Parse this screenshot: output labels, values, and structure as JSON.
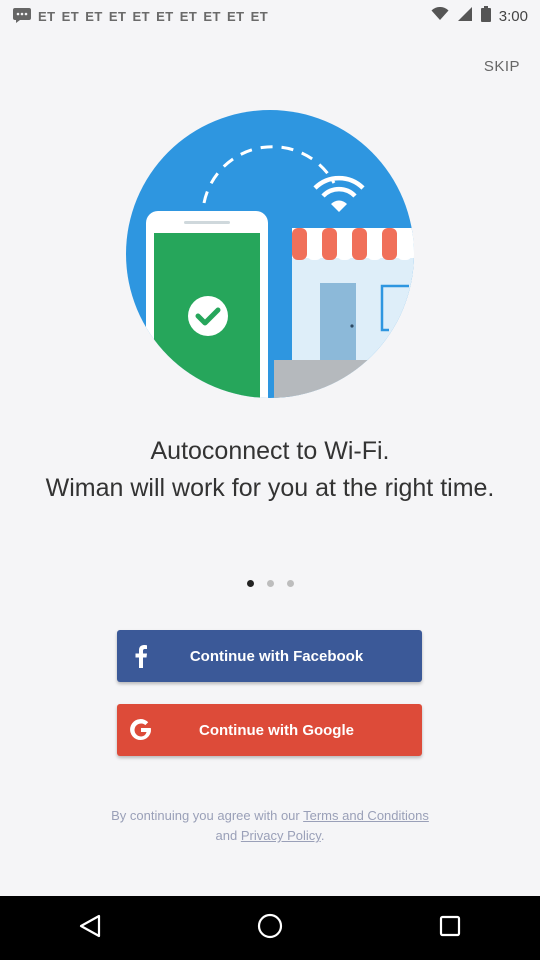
{
  "status_bar": {
    "notifications": [
      "ET",
      "ET",
      "ET",
      "ET",
      "ET",
      "ET",
      "ET",
      "ET",
      "ET",
      "ET"
    ],
    "time": "3:00"
  },
  "skip_label": "SKIP",
  "headline": {
    "line1": "Autoconnect to Wi-Fi.",
    "line2": "Wiman will work for you at the right time."
  },
  "pager": {
    "count": 3,
    "active_index": 0
  },
  "buttons": {
    "facebook": {
      "label": "Continue with Facebook",
      "icon": "facebook-f-icon",
      "color": "#3b5998"
    },
    "google": {
      "label": "Continue with Google",
      "icon": "google-g-icon",
      "color": "#dd4b39"
    }
  },
  "legal": {
    "prefix": "By continuing you agree with our ",
    "terms_link": "Terms and Conditions",
    "middle": " and ",
    "privacy_link": "Privacy Policy",
    "suffix": "."
  },
  "colors": {
    "hero_blue": "#2e96e0",
    "phone_green": "#26a65b",
    "awning_red": "#f0705a"
  }
}
